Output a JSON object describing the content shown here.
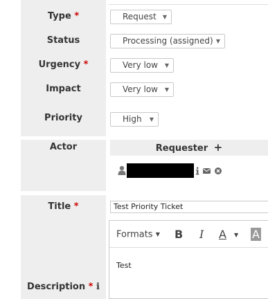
{
  "fields": {
    "type": {
      "label": "Type",
      "required": "*",
      "value": "Request"
    },
    "status": {
      "label": "Status",
      "value": "Processing (assigned)"
    },
    "urgency": {
      "label": "Urgency",
      "required": "*",
      "value": "Very low"
    },
    "impact": {
      "label": "Impact",
      "value": "Very low"
    },
    "priority": {
      "label": "Priority",
      "value": "High"
    }
  },
  "actor": {
    "label": "Actor",
    "requester_header": "Requester",
    "add_symbol": "+"
  },
  "title_field": {
    "label": "Title",
    "required": "*",
    "value": "Test Priority Ticket"
  },
  "description_field": {
    "label": "Description",
    "required": "*",
    "info_symbol": "i",
    "toolbar": {
      "formats_label": "Formats",
      "bold": "B",
      "italic": "I",
      "font_color": "A",
      "background_color": "A"
    },
    "body_text": "Test"
  },
  "dropdown_arrow": "▼",
  "icons": [
    "user-icon",
    "info-icon",
    "envelope-icon",
    "remove-icon",
    "plus-icon",
    "chevron-down-icon"
  ]
}
